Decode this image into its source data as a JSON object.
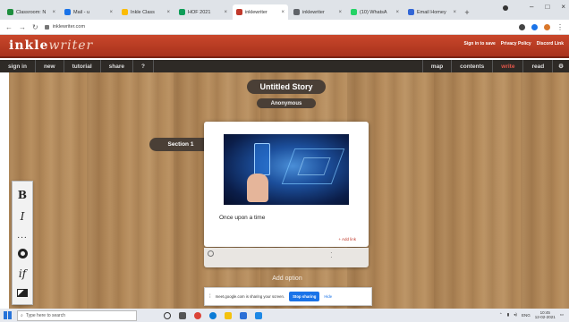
{
  "browser": {
    "tabs": [
      {
        "label": "Classroom: N",
        "color": "#1e8e3e"
      },
      {
        "label": "Mail - u",
        "color": "#1a73e8"
      },
      {
        "label": "Inkle Class",
        "color": "#fbbc04"
      },
      {
        "label": "HOF 2021",
        "color": "#0f9d58"
      },
      {
        "label": "inklewriter",
        "color": "#c0392b"
      },
      {
        "label": "inklewriter",
        "color": "#5f6368"
      },
      {
        "label": "(10) WhatsA",
        "color": "#25d366"
      },
      {
        "label": "Email Homey",
        "color": "#3367d6"
      }
    ],
    "url": "inklewriter.com"
  },
  "app": {
    "logo": "inkle",
    "logo_suffix": "writer",
    "top_links": [
      "Sign in to save",
      "Privacy Policy",
      "Discord Link"
    ]
  },
  "toolbar": {
    "left": [
      "sign in",
      "new",
      "tutorial",
      "share",
      "?"
    ],
    "right": [
      "map",
      "contents",
      "write",
      "read"
    ]
  },
  "story": {
    "title": "Untitled Story",
    "author": "Anonymous",
    "section": "Section 1",
    "paragraph": "Once upon a time",
    "card_link": "+ Add link",
    "add_option": "Add option"
  },
  "format_tools": {
    "bold": "B",
    "italic": "I",
    "more": "...",
    "if": "if"
  },
  "screen_share": {
    "message": "meet.google.com is sharing your screen.",
    "stop": "Stop sharing",
    "hide": "Hide"
  },
  "taskbar": {
    "search_placeholder": "Type here to search",
    "time": "10:45",
    "date": "12-02-2021"
  }
}
